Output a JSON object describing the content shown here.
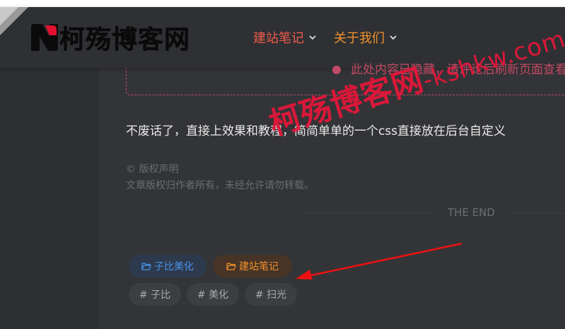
{
  "header": {
    "logo_text": "柯殇博客网",
    "nav": [
      {
        "label": "建站笔记",
        "color": "#ef5a4a"
      },
      {
        "label": "关于我们",
        "color": "#f0922a"
      }
    ]
  },
  "article": {
    "hidden_notice": "此处内容已隐藏，请评论后刷新页面查看",
    "paragraph": "不废话了，直接上效果和教程，简简单单的一个css直接放在后台自定义",
    "copyright_title": "© 版权声明",
    "copyright_text": "文章版权归作者所有，未经允许请勿转载。",
    "the_end": "THE END"
  },
  "categories": [
    {
      "label": "子比美化",
      "color": "#4a92e8"
    },
    {
      "label": "建站笔记",
      "color": "#f0922a"
    }
  ],
  "tags": [
    "# 子比",
    "# 美化",
    "# 扫光"
  ],
  "watermark": {
    "text": "柯殇博客网",
    "url": "-kshkw.com",
    "color": "#e8163a"
  }
}
